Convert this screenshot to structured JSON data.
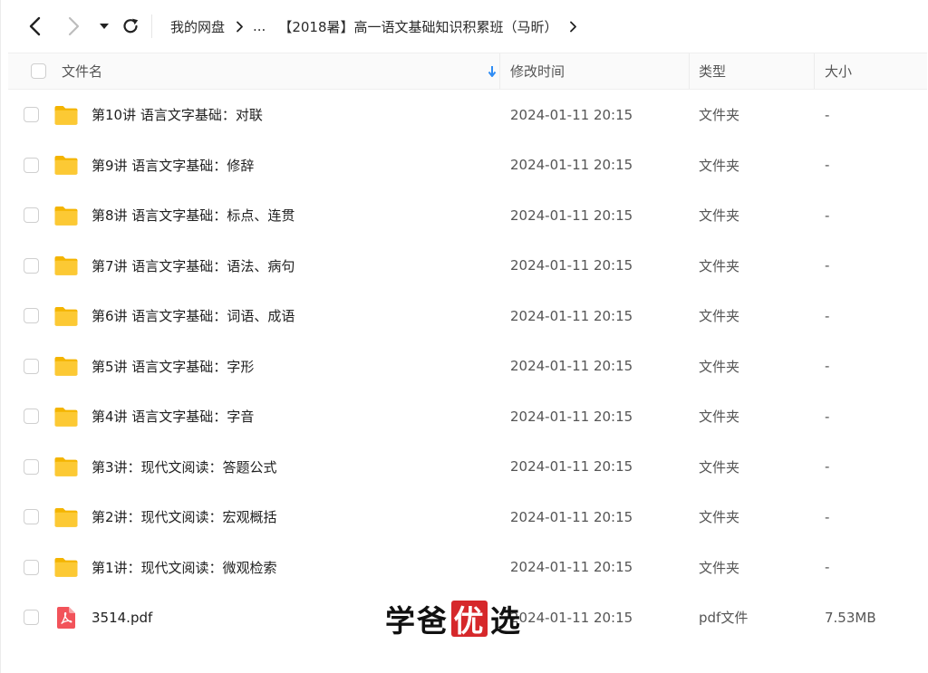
{
  "breadcrumb": {
    "root": "我的网盘",
    "ellipsis": "...",
    "current": "【2018暑】高一语文基础知识积累班（马昕）"
  },
  "columns": {
    "name": "文件名",
    "modified": "修改时间",
    "type": "类型",
    "size": "大小"
  },
  "files": [
    {
      "name": "第10讲 语言文字基础：对联",
      "modified": "2024-01-11 20:15",
      "type": "文件夹",
      "size": "-",
      "kind": "folder"
    },
    {
      "name": "第9讲 语言文字基础：修辞",
      "modified": "2024-01-11 20:15",
      "type": "文件夹",
      "size": "-",
      "kind": "folder"
    },
    {
      "name": "第8讲 语言文字基础：标点、连贯",
      "modified": "2024-01-11 20:15",
      "type": "文件夹",
      "size": "-",
      "kind": "folder"
    },
    {
      "name": "第7讲 语言文字基础：语法、病句",
      "modified": "2024-01-11 20:15",
      "type": "文件夹",
      "size": "-",
      "kind": "folder"
    },
    {
      "name": "第6讲 语言文字基础：词语、成语",
      "modified": "2024-01-11 20:15",
      "type": "文件夹",
      "size": "-",
      "kind": "folder"
    },
    {
      "name": "第5讲 语言文字基础：字形",
      "modified": "2024-01-11 20:15",
      "type": "文件夹",
      "size": "-",
      "kind": "folder"
    },
    {
      "name": "第4讲 语言文字基础：字音",
      "modified": "2024-01-11 20:15",
      "type": "文件夹",
      "size": "-",
      "kind": "folder"
    },
    {
      "name": "第3讲：现代文阅读：答题公式",
      "modified": "2024-01-11 20:15",
      "type": "文件夹",
      "size": "-",
      "kind": "folder"
    },
    {
      "name": "第2讲：现代文阅读：宏观概括",
      "modified": "2024-01-11 20:15",
      "type": "文件夹",
      "size": "-",
      "kind": "folder"
    },
    {
      "name": "第1讲：现代文阅读：微观检索",
      "modified": "2024-01-11 20:15",
      "type": "文件夹",
      "size": "-",
      "kind": "folder"
    },
    {
      "name": "3514.pdf",
      "modified": "2024-01-11 20:15",
      "type": "pdf文件",
      "size": "7.53MB",
      "kind": "pdf"
    }
  ],
  "watermark": {
    "c1": "学",
    "c2": "爸",
    "c3": "优",
    "c4": "选"
  },
  "colors": {
    "folder": "#f7c21b",
    "pdf": "#f2535a",
    "sort_arrow": "#2f8cf4",
    "seal": "#d6282b"
  },
  "icons": {
    "back": "chevron-left-icon",
    "forward": "chevron-right-icon",
    "dropdown": "caret-down-icon",
    "refresh": "refresh-icon",
    "sort": "arrow-down-icon",
    "folder": "folder-icon",
    "pdf": "pdf-icon"
  }
}
